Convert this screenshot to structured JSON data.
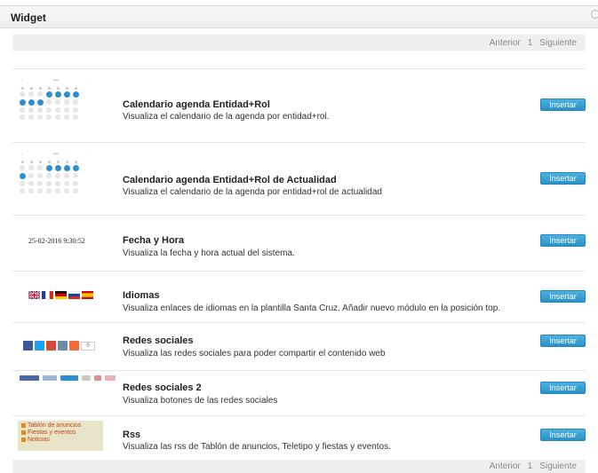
{
  "panel": {
    "title": "Widget"
  },
  "pager": {
    "prev": "Anterior",
    "page": "1",
    "next": "Siguiente"
  },
  "widgets": [
    {
      "title": "Calendario agenda Entidad+Rol",
      "description": "Visualiza el calendario de la agenda por entidad+rol.",
      "button": "Insertar",
      "preview": "calendar"
    },
    {
      "title": "Calendario agenda Entidad+Rol de Actualidad",
      "description": "Visualiza el calendario de la agenda por entidad+rol de actualidad",
      "button": "Insertar",
      "preview": "calendar"
    },
    {
      "title": "Fecha y Hora",
      "description": "Visualiza la fecha y hora actual del sistema.",
      "button": "Insertar",
      "preview_text": "25-02-2016 9:30:52"
    },
    {
      "title": "Idiomas",
      "description": "Visualiza enlaces de idiomas en la plantilla Santa Cruz. Añadir nuevo módulo en la posición top.",
      "button": "Insertar",
      "preview": "flags"
    },
    {
      "title": "Redes sociales",
      "description": "Visualiza las redes sociales para poder compartir el contenido web",
      "button": "Insertar",
      "preview": "social-buttons",
      "share_count": "0"
    },
    {
      "title": "Redes sociales 2",
      "description": "Visualiza botones de las redes sociales",
      "button": "Insertar",
      "preview": "share-bar"
    },
    {
      "title": "Rss",
      "description": "Visualiza las rss de Tablón de anuncios, Teletipo y fiestas y eventos.",
      "button": "Insertar",
      "preview_items": [
        "Tablón de anuncios",
        "Fiestas y eventos",
        "Noticias"
      ]
    }
  ],
  "colors": {
    "accent": "#2b91c6",
    "calendar_highlight": "#2f8fcc",
    "rss_bg": "#e8e4c8"
  }
}
